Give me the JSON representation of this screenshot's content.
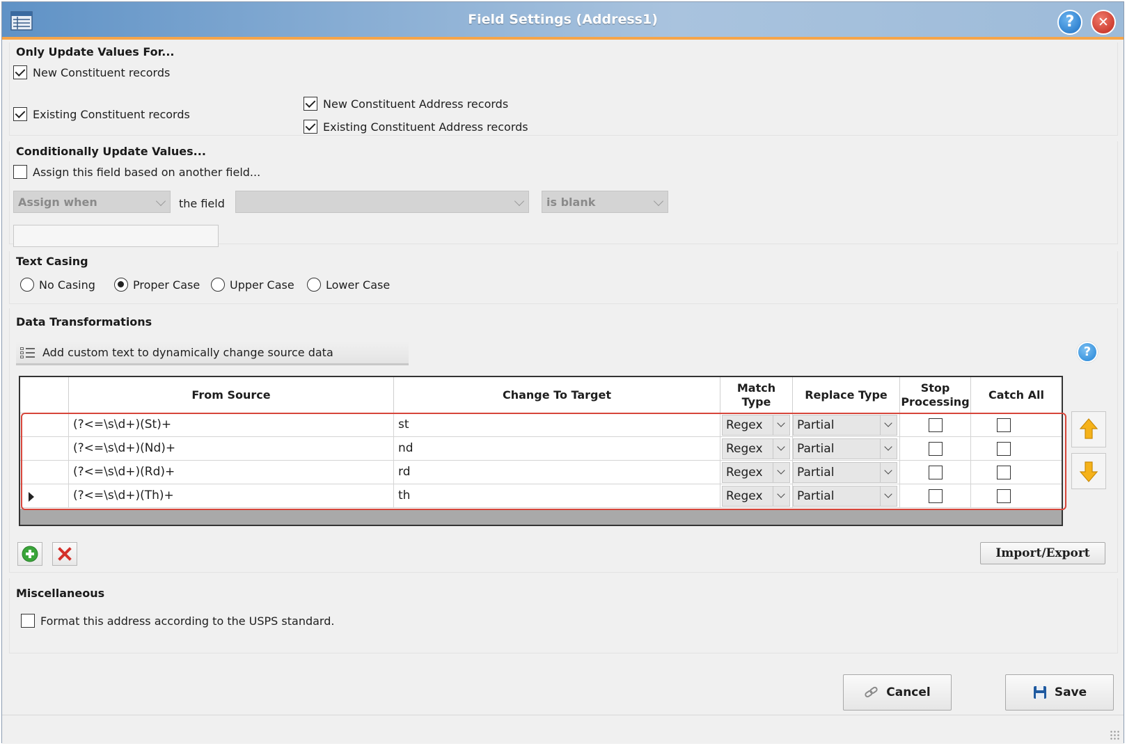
{
  "window": {
    "title": "Field Settings (Address1)",
    "help_symbol": "?",
    "close_symbol": "✕"
  },
  "only_update": {
    "title": "Only Update Values For...",
    "new_constituent": {
      "label": "New Constituent records",
      "checked": true
    },
    "existing_constituent": {
      "label": "Existing Constituent records",
      "checked": true
    },
    "new_address": {
      "label": "New Constituent Address records",
      "checked": true
    },
    "existing_address": {
      "label": "Existing Constituent Address records",
      "checked": true
    }
  },
  "conditional": {
    "title": "Conditionally Update Values...",
    "assign_based": {
      "label": "Assign this field based on another field...",
      "checked": false
    },
    "assign_when": "Assign when",
    "the_field_label": "the field",
    "field_value": "",
    "condition": "is blank",
    "value_text": ""
  },
  "text_casing": {
    "title": "Text Casing",
    "options": [
      "No Casing",
      "Proper Case",
      "Upper Case",
      "Lower Case"
    ],
    "selected": "Proper Case"
  },
  "transformations": {
    "title": "Data Transformations",
    "add_custom_text": "Add custom text to dynamically change source data",
    "help_symbol": "?",
    "columns": {
      "from_source": "From Source",
      "change_to_target": "Change To Target",
      "match_type_1": "Match",
      "match_type_2": "Type",
      "replace_type": "Replace Type",
      "stop_processing_1": "Stop",
      "stop_processing_2": "Processing",
      "catch_all": "Catch All"
    },
    "rows": [
      {
        "from": "(?<=\\s\\d+)(St)+",
        "to": "st",
        "match": "Regex",
        "replace": "Partial",
        "stop": false,
        "catch_all": false,
        "current": false
      },
      {
        "from": "(?<=\\s\\d+)(Nd)+",
        "to": "nd",
        "match": "Regex",
        "replace": "Partial",
        "stop": false,
        "catch_all": false,
        "current": false
      },
      {
        "from": "(?<=\\s\\d+)(Rd)+",
        "to": "rd",
        "match": "Regex",
        "replace": "Partial",
        "stop": false,
        "catch_all": false,
        "current": false
      },
      {
        "from": "(?<=\\s\\d+)(Th)+",
        "to": "th",
        "match": "Regex",
        "replace": "Partial",
        "stop": false,
        "catch_all": false,
        "current": true
      }
    ],
    "import_export": "Import/Export"
  },
  "misc": {
    "title": "Miscellaneous",
    "usps": {
      "label": "Format this address according to the USPS standard.",
      "checked": false
    }
  },
  "footer": {
    "cancel": "Cancel",
    "save": "Save"
  },
  "colors": {
    "title_accent": "#f6a54a",
    "highlight": "#d6453a",
    "help_blue": "#2384d6",
    "arrow_orange": "#f5b21a",
    "add_green": "#3aa53a",
    "delete_red": "#d4302a"
  }
}
